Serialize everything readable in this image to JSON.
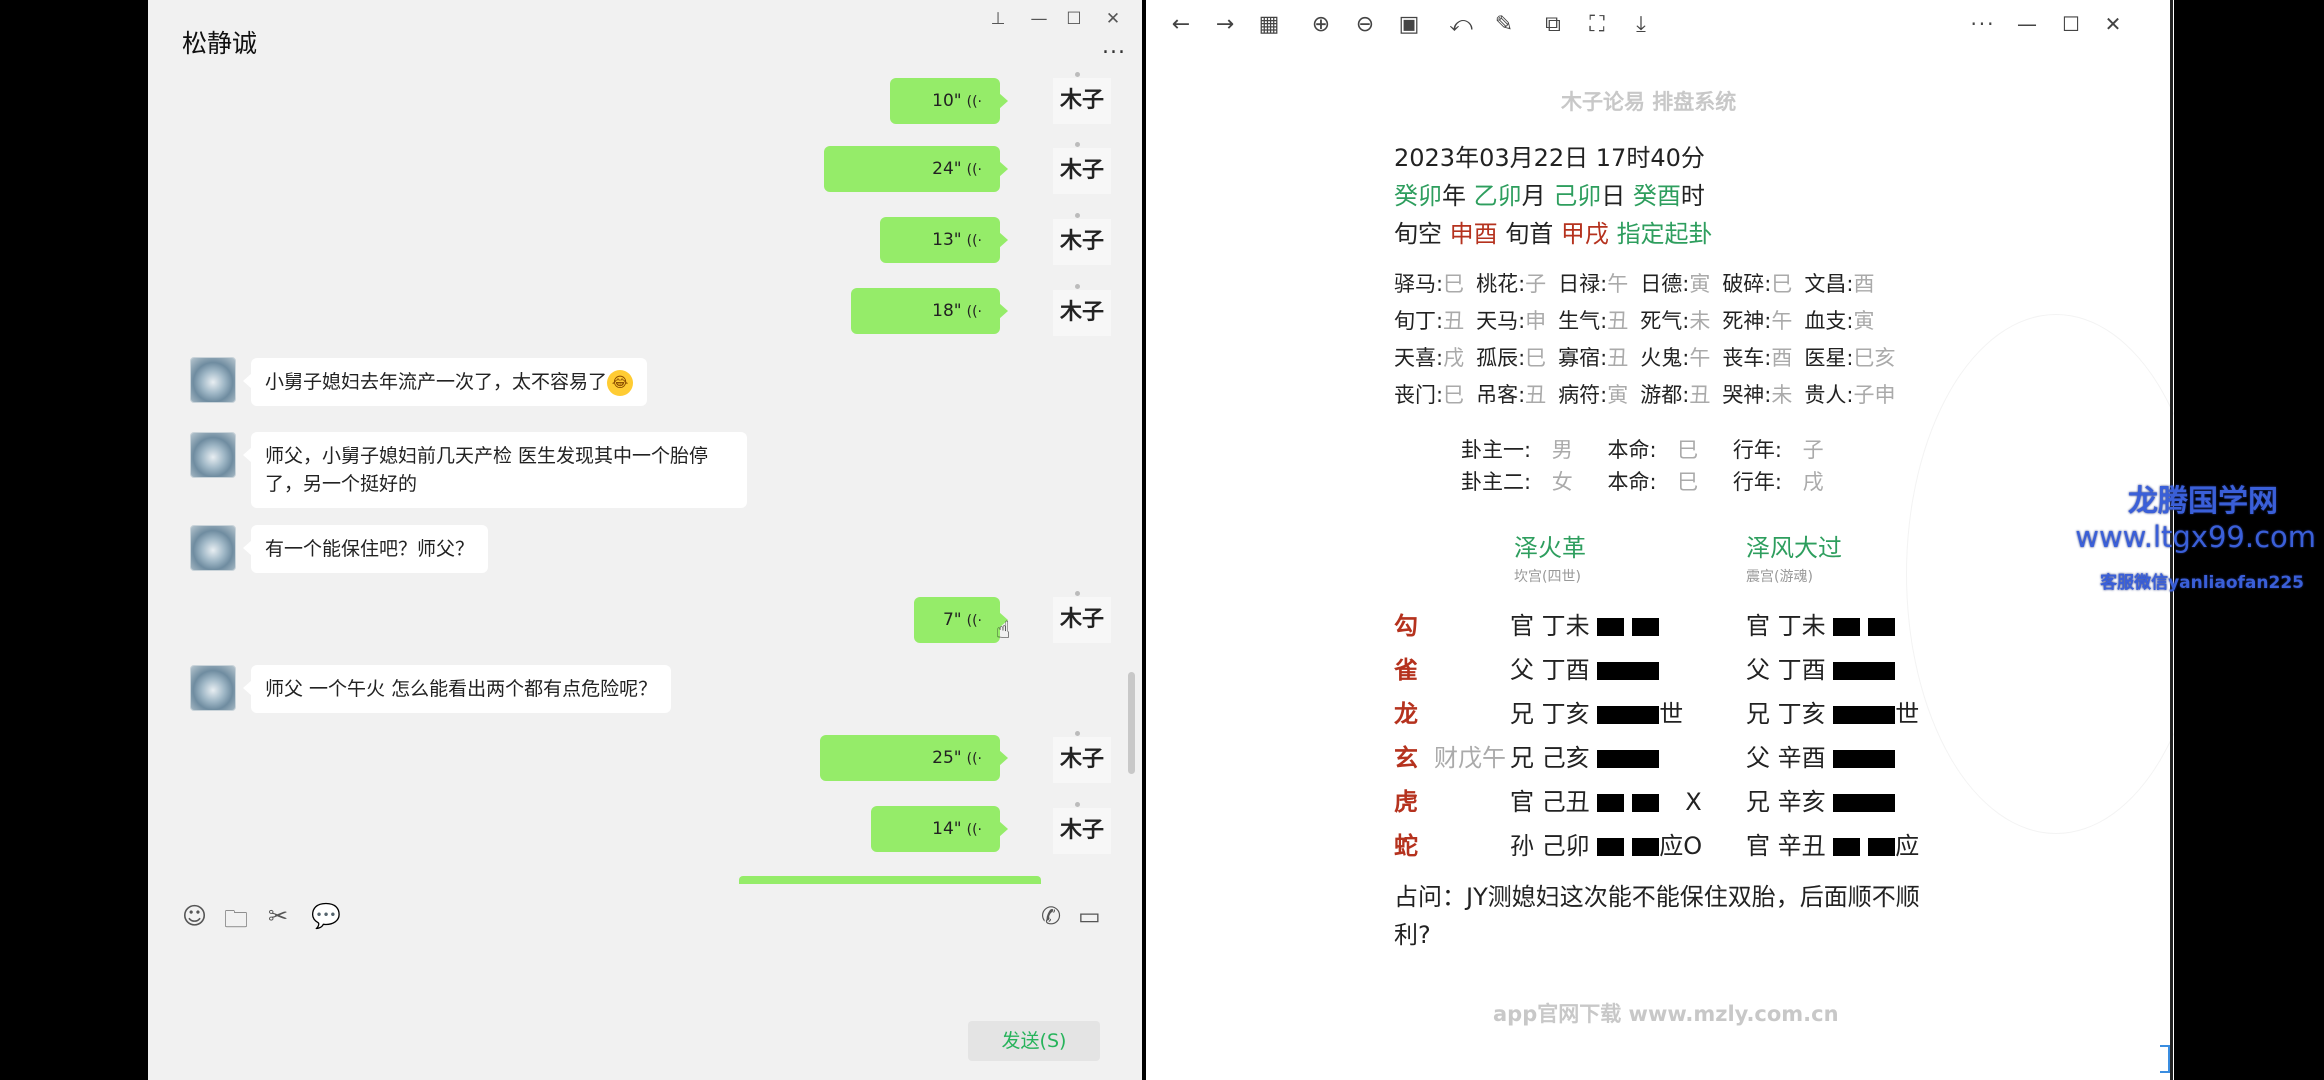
{
  "chat": {
    "title": "松静诚",
    "more_label": "...",
    "sender_name": "木子",
    "voice_messages_top": [
      "10\"",
      "24\"",
      "13\"",
      "18\""
    ],
    "voice_messages_middle": [
      "7\""
    ],
    "voice_messages_bottom": [
      "25\"",
      "14\""
    ],
    "incoming": [
      "小舅子媳妇去年流产一次了，太不容易了",
      "师父，小舅子媳妇前几天产检 医生发现其中一个胎停了，另一个挺好的",
      "有一个能保住吧？师父？",
      "师父 一个午火 怎么能看出两个都有点危险呢？"
    ],
    "send_label": "发送(S)"
  },
  "viewer": {
    "watermark_top": "木子论易 排盘系统",
    "datetime": "2023年03月22日 17时40分",
    "ganzhi": {
      "year": "癸卯",
      "year_suffix": "年",
      "month": "乙卯",
      "month_suffix": "月",
      "day": "己卯",
      "day_suffix": "日",
      "hour": "癸酉",
      "hour_suffix": "时"
    },
    "xunkong_label": "旬空",
    "xunkong": "申酉",
    "xunshou_label": "旬首",
    "xunshou": "甲戌",
    "method": "指定起卦",
    "shensha": [
      [
        [
          "驿马:",
          "巳"
        ],
        [
          "桃花:",
          "子"
        ],
        [
          "日禄:",
          "午"
        ],
        [
          "日德:",
          "寅"
        ],
        [
          "破碎:",
          "巳"
        ],
        [
          "文昌:",
          "酉"
        ]
      ],
      [
        [
          "旬丁:",
          "丑"
        ],
        [
          "天马:",
          "申"
        ],
        [
          "生气:",
          "丑"
        ],
        [
          "死气:",
          "未"
        ],
        [
          "死神:",
          "午"
        ],
        [
          "血支:",
          "寅"
        ]
      ],
      [
        [
          "天喜:",
          "戌"
        ],
        [
          "孤辰:",
          "巳"
        ],
        [
          "寡宿:",
          "丑"
        ],
        [
          "火鬼:",
          "午"
        ],
        [
          "丧车:",
          "酉"
        ],
        [
          "医星:",
          "巳亥"
        ]
      ],
      [
        [
          "丧门:",
          "巳"
        ],
        [
          "吊客:",
          "丑"
        ],
        [
          "病符:",
          "寅"
        ],
        [
          "游都:",
          "丑"
        ],
        [
          "哭神:",
          "未"
        ],
        [
          "贵人:",
          "子申"
        ]
      ]
    ],
    "guazhu1": {
      "label": "卦主一:",
      "sex": "男",
      "ming_label": "本命:",
      "ming": "巳",
      "nian_label": "行年:",
      "nian": "子"
    },
    "guazhu2": {
      "label": "卦主二:",
      "sex": "女",
      "ming_label": "本命:",
      "ming": "巳",
      "nian_label": "行年:",
      "nian": "戌"
    },
    "main_gua": {
      "name": "泽火革",
      "palace": "坎宫(四世)"
    },
    "changed_gua": {
      "name": "泽风大过",
      "palace": "震宫(游魂)"
    },
    "gods": [
      "勾",
      "雀",
      "龙",
      "玄",
      "虎",
      "蛇"
    ],
    "fushen": [
      "",
      "",
      "",
      "财戊午",
      "",
      ""
    ],
    "main_lines": [
      "官 丁未",
      "父 丁酉",
      "兄 丁亥",
      "兄 己亥",
      "官 己丑",
      "孙 己卯"
    ],
    "main_marks": [
      "",
      "",
      "世",
      "",
      "X",
      "应O"
    ],
    "changed_lines": [
      "官 丁未",
      "父 丁酉",
      "兄 丁亥",
      "父 辛酉",
      "兄 辛亥",
      "官 辛丑"
    ],
    "changed_marks": [
      "",
      "",
      "世",
      "",
      "",
      "应"
    ],
    "question": "占问：JY测媳妇这次能不能保住双胎，后面顺不顺利?",
    "watermark_bottom": "app官网下载 www.mzly.com.cn"
  },
  "site_watermark": {
    "name": "龙腾国学网",
    "url": "www.ltgx99.com",
    "contact": "客服微信yanliaofan225"
  }
}
